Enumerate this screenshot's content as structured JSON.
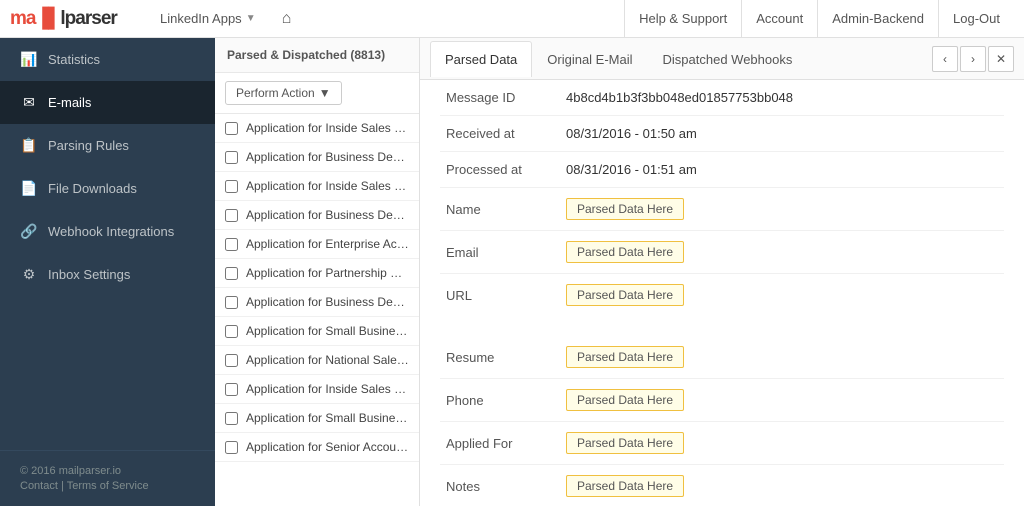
{
  "logo": {
    "text_red": "ma",
    "icon": "▐▌",
    "text_black": "lparser"
  },
  "top_nav": {
    "center_links": [
      {
        "id": "linkedin-apps",
        "label": "LinkedIn Apps",
        "has_dropdown": true
      },
      {
        "id": "home",
        "label": "🏠",
        "is_home": true
      }
    ],
    "right_links": [
      {
        "id": "help-support",
        "label": "Help & Support"
      },
      {
        "id": "account",
        "label": "Account"
      },
      {
        "id": "admin-backend",
        "label": "Admin-Backend"
      },
      {
        "id": "log-out",
        "label": "Log-Out"
      }
    ]
  },
  "sidebar": {
    "items": [
      {
        "id": "statistics",
        "label": "Statistics",
        "icon": "📊",
        "active": false
      },
      {
        "id": "emails",
        "label": "E-mails",
        "icon": "✉",
        "active": true
      },
      {
        "id": "parsing-rules",
        "label": "Parsing Rules",
        "icon": "📋",
        "active": false
      },
      {
        "id": "file-downloads",
        "label": "File Downloads",
        "icon": "📄",
        "active": false
      },
      {
        "id": "webhook-integrations",
        "label": "Webhook Integrations",
        "icon": "🔗",
        "active": false
      },
      {
        "id": "inbox-settings",
        "label": "Inbox Settings",
        "icon": "⚙",
        "active": false
      }
    ],
    "footer": {
      "copyright": "© 2016 mailparser.io",
      "links": [
        "Contact",
        "Terms of Service"
      ]
    }
  },
  "email_list": {
    "header": "Parsed & Dispatched (8813)",
    "toolbar": {
      "perform_action_label": "Perform Action",
      "dropdown_arrow": "▼"
    },
    "emails": [
      {
        "id": 1,
        "text": "Application for Inside Sales fro..."
      },
      {
        "id": 2,
        "text": "Application for Business Deve..."
      },
      {
        "id": 3,
        "text": "Application for Inside Sales fro..."
      },
      {
        "id": 4,
        "text": "Application for Business Deve..."
      },
      {
        "id": 5,
        "text": "Application for Enterprise Acc..."
      },
      {
        "id": 6,
        "text": "Application for Partnership Sa..."
      },
      {
        "id": 7,
        "text": "Application for Business Deve..."
      },
      {
        "id": 8,
        "text": "Application for Small Business..."
      },
      {
        "id": 9,
        "text": "Application for National Sales ..."
      },
      {
        "id": 10,
        "text": "Application for Inside Sales fro..."
      },
      {
        "id": 11,
        "text": "Application for Small Business..."
      },
      {
        "id": 12,
        "text": "Application for Senior Account..."
      }
    ]
  },
  "detail": {
    "tabs": [
      {
        "id": "parsed-data",
        "label": "Parsed Data",
        "active": true
      },
      {
        "id": "original-email",
        "label": "Original E-Mail",
        "active": false
      },
      {
        "id": "dispatched-webhooks",
        "label": "Dispatched Webhooks",
        "active": false
      }
    ],
    "nav_buttons": [
      "‹",
      "›",
      "✕"
    ],
    "fields_top": [
      {
        "id": "message-id",
        "label": "Message ID",
        "value": "4b8cd4b1b3f3bb048ed01857753bb048",
        "is_parsed": false
      },
      {
        "id": "received-at",
        "label": "Received at",
        "value": "08/31/2016 - 01:50 am",
        "is_parsed": false
      },
      {
        "id": "processed-at",
        "label": "Processed at",
        "value": "08/31/2016 - 01:51 am",
        "is_parsed": false
      },
      {
        "id": "name",
        "label": "Name",
        "value": "Parsed Data Here",
        "is_parsed": true
      },
      {
        "id": "email",
        "label": "Email",
        "value": "Parsed Data Here",
        "is_parsed": true
      },
      {
        "id": "url",
        "label": "URL",
        "value": "Parsed Data Here",
        "is_parsed": true
      }
    ],
    "fields_bottom": [
      {
        "id": "resume",
        "label": "Resume",
        "value": "Parsed Data Here",
        "is_parsed": true
      },
      {
        "id": "phone",
        "label": "Phone",
        "value": "Parsed Data Here",
        "is_parsed": true
      },
      {
        "id": "applied-for",
        "label": "Applied For",
        "value": "Parsed Data Here",
        "is_parsed": true
      },
      {
        "id": "notes",
        "label": "Notes",
        "value": "Parsed Data Here",
        "is_parsed": true
      }
    ]
  }
}
